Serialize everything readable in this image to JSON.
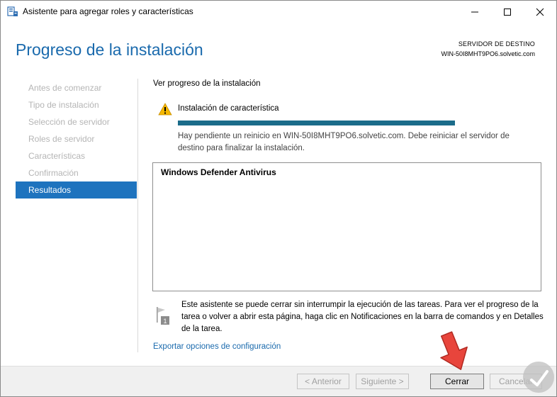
{
  "window": {
    "title": "Asistente para agregar roles y características",
    "minimize_label": "minimize",
    "maximize_label": "maximize",
    "close_label": "close"
  },
  "header": {
    "page_title": "Progreso de la instalación",
    "dest_label": "SERVIDOR DE DESTINO",
    "dest_server": "WIN-50I8MHT9PO6.solvetic.com"
  },
  "nav": {
    "items": [
      {
        "label": "Antes de comenzar",
        "active": false
      },
      {
        "label": "Tipo de instalación",
        "active": false
      },
      {
        "label": "Selección de servidor",
        "active": false
      },
      {
        "label": "Roles de servidor",
        "active": false
      },
      {
        "label": "Características",
        "active": false
      },
      {
        "label": "Confirmación",
        "active": false
      },
      {
        "label": "Resultados",
        "active": true
      }
    ]
  },
  "main": {
    "section_label": "Ver progreso de la instalación",
    "feature_status": "Instalación de característica",
    "progress_fraction": 1.0,
    "notice": "Hay pendiente un reinicio en WIN-50I8MHT9PO6.solvetic.com. Debe reiniciar el servidor de destino para finalizar la instalación.",
    "results": [
      "Windows Defender Antivirus"
    ],
    "info_text": "Este asistente se puede cerrar sin interrumpir la ejecución de las tareas. Para ver el progreso de la tarea o volver a abrir esta página, haga clic en Notificaciones en la barra de comandos y en Detalles de la tarea.",
    "export_link": "Exportar opciones de configuración"
  },
  "footer": {
    "prev_label": "< Anterior",
    "next_label": "Siguiente >",
    "close_label": "Cerrar",
    "cancel_label": "Cancelar"
  },
  "colors": {
    "accent": "#1e73be",
    "title_blue": "#1a6aad",
    "progress": "#1b6c8a",
    "warning": "#f5b800",
    "arrow": "#e8453c"
  },
  "icons": {
    "app": "server-manager-icon",
    "warning": "warning-icon",
    "flag": "notification-flag-icon",
    "arrow": "pointer-arrow-icon",
    "logo": "solvetic-logo-icon"
  }
}
